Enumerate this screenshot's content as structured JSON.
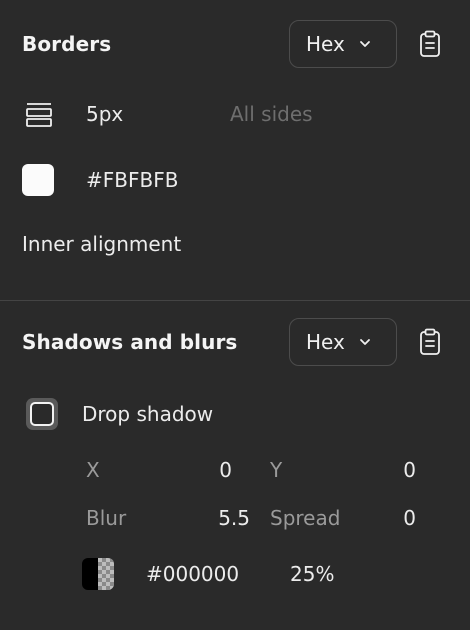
{
  "borders": {
    "title": "Borders",
    "format_dropdown": "Hex",
    "width_value": "5px",
    "sides_value": "All sides",
    "color_value": "#FBFBFB",
    "inner_alignment_label": "Inner alignment"
  },
  "shadows": {
    "title": "Shadows and blurs",
    "format_dropdown": "Hex",
    "drop_shadow_label": "Drop shadow",
    "drop_shadow_checked": false,
    "x_label": "X",
    "x_value": "0",
    "y_label": "Y",
    "y_value": "0",
    "blur_label": "Blur",
    "blur_value": "5.5",
    "spread_label": "Spread",
    "spread_value": "0",
    "color_value": "#000000",
    "opacity_value": "25%"
  },
  "colors": {
    "panel_bg": "#2a2a2a",
    "border_color_swatch": "#FBFBFB",
    "shadow_color_swatch": "#000000"
  },
  "icons": {
    "chevron": "chevron-down-icon",
    "clipboard": "clipboard-icon",
    "border_width": "border-width-icon"
  }
}
